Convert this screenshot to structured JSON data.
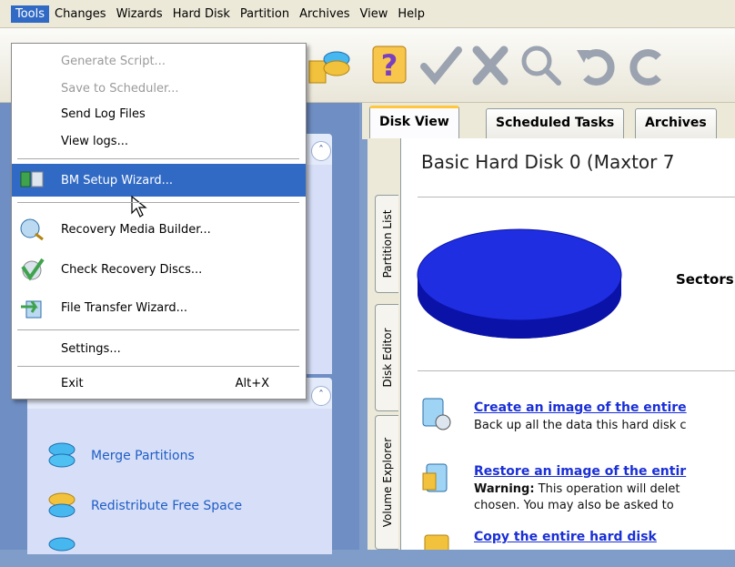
{
  "menubar": {
    "items": [
      "Tools",
      "Changes",
      "Wizards",
      "Hard Disk",
      "Partition",
      "Archives",
      "View",
      "Help"
    ]
  },
  "tools_menu": {
    "items": [
      {
        "label": "Generate Script...",
        "enabled": false
      },
      {
        "label": "Save to Scheduler...",
        "enabled": false
      },
      {
        "label": "Send Log Files",
        "enabled": true
      },
      {
        "label": "View logs...",
        "enabled": true
      },
      {
        "label": "BM Setup Wizard...",
        "enabled": true,
        "highlighted": true,
        "icon": "setup-wizard-icon"
      },
      {
        "label": "Recovery Media Builder...",
        "enabled": true,
        "icon": "recovery-media-icon"
      },
      {
        "label": "Check Recovery Discs...",
        "enabled": true,
        "icon": "check-discs-icon"
      },
      {
        "label": "File Transfer Wizard...",
        "enabled": true,
        "icon": "file-transfer-icon"
      },
      {
        "label": "Settings...",
        "enabled": true
      },
      {
        "label": "Exit",
        "shortcut": "Alt+X",
        "enabled": true
      }
    ]
  },
  "tabs": [
    "Disk View",
    "Scheduled Tasks",
    "Archives"
  ],
  "vertical_tabs": [
    "Partition List",
    "Disk Editor",
    "Volume Explorer"
  ],
  "content": {
    "title": "Basic Hard Disk 0 (Maxtor 7",
    "sectors_label": "Sectors",
    "operations": [
      {
        "link": "Create an image of the entire",
        "desc": "Back up all the data this hard disk c",
        "icon": "create-image-icon"
      },
      {
        "link": "Restore an image of the entir",
        "desc_bold": "Warning:",
        "desc": " This operation will delet",
        "desc2": "chosen. You may also be asked to",
        "icon": "restore-image-icon"
      },
      {
        "link": "Copy the entire hard disk",
        "icon": "copy-disk-icon"
      }
    ]
  },
  "left_tasks": [
    {
      "label": "Merge Partitions",
      "icon": "merge-partitions-icon"
    },
    {
      "label": "Redistribute Free Space",
      "icon": "redistribute-space-icon"
    }
  ],
  "colors": {
    "menu_highlight": "#316ac5",
    "link_blue": "#1a2fd6",
    "task_link": "#215dc6",
    "disk_blue": "#1f2ee0",
    "left_pane": "#6f8fc4"
  }
}
